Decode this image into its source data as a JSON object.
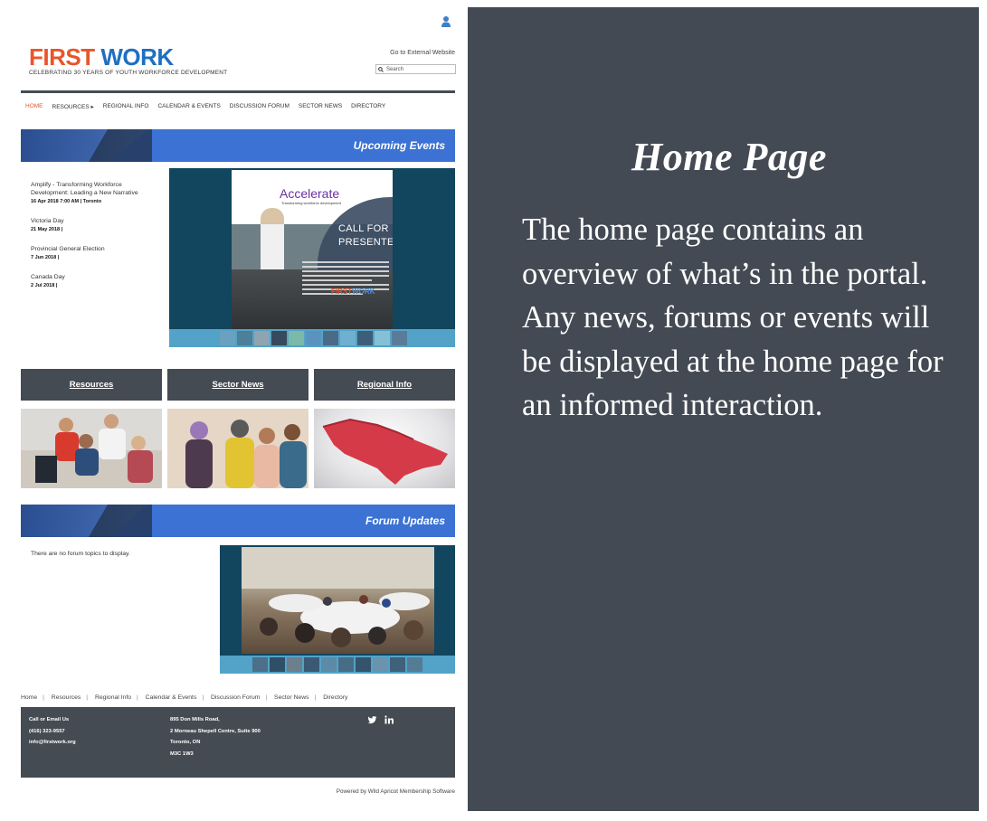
{
  "site": {
    "logo_word1": "FIRST",
    "logo_word2": "WORK",
    "tagline": "CELEBRATING 30 YEARS OF YOUTH WORKFORCE DEVELOPMENT",
    "external_link": "Go to External Website",
    "search_placeholder": "Search",
    "brand_colors": {
      "orange": "#e8562a",
      "blue": "#1f6fc1",
      "dark": "#444b53",
      "banner": "#3b72d4"
    }
  },
  "nav": {
    "items": [
      "HOME",
      "RESOURCES ▸",
      "REGIONAL INFO",
      "CALENDAR & EVENTS",
      "DISCUSSION FORUM",
      "SECTOR NEWS",
      "DIRECTORY"
    ]
  },
  "events": {
    "banner_title": "Upcoming Events",
    "items": [
      {
        "title": "Amplify - Transforming Workforce Development: Leading a New Narrative",
        "date": "16 Apr 2018 7:00 AM | Toronto"
      },
      {
        "title": "Victoria Day",
        "date": "21 May 2018 |"
      },
      {
        "title": "Provincial General Election",
        "date": "7 Jun 2018 |"
      },
      {
        "title": "Canada Day",
        "date": "2 Jul 2018 |"
      }
    ],
    "image": {
      "brand": "Accelerate",
      "brand_sub": "Transforming workforce development",
      "headline_1": "CALL FOR",
      "headline_2": "PRESENTERS",
      "footer_brand_1": "FIRST",
      "footer_brand_2": "WORK"
    }
  },
  "quick_links": {
    "resources": "Resources",
    "sector_news": "Sector News",
    "regional_info": "Regional Info"
  },
  "forum": {
    "banner_title": "Forum Updates",
    "empty_text": "There are no forum topics to display."
  },
  "footer": {
    "links": [
      "Home",
      "Resources",
      "Regional Info",
      "Calendar & Events",
      "Discussion Forum",
      "Sector News",
      "Directory"
    ],
    "contact": [
      "Call or Email Us",
      "(416) 323-9557",
      "info@firstwork.org"
    ],
    "address": [
      "895 Don Mills Road,",
      "2 Morneau Shepell Centre, Suite 900",
      "Toronto, ON",
      "M3C 1W3"
    ],
    "social_icons": [
      "twitter-icon",
      "linkedin-icon"
    ],
    "powered_by": "Powered by Wild Apricot Membership Software"
  },
  "panel": {
    "title": "Home Page",
    "body": "The home page contains an overview of what’s in the portal. Any news, forums or events will be displayed at the home page for an informed interaction.",
    "background": "#434a54"
  }
}
